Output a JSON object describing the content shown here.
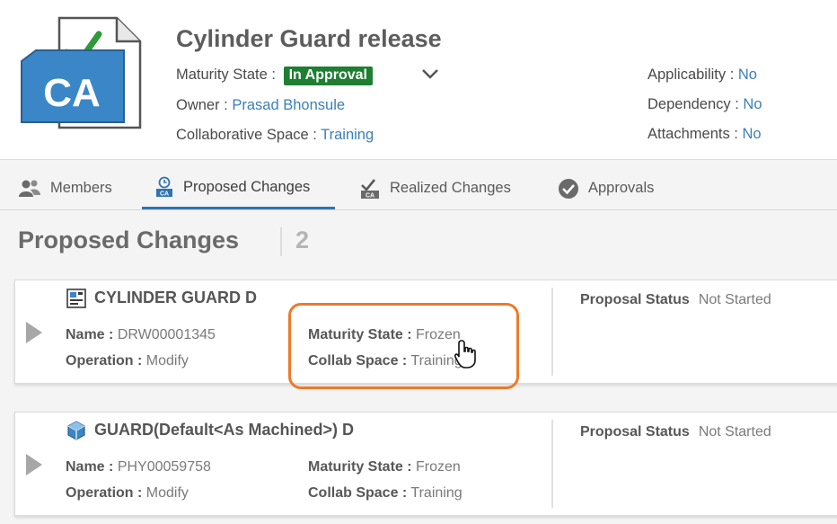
{
  "header": {
    "title": "Cylinder Guard release",
    "icon_text": "CA",
    "maturity_label": "Maturity State :",
    "maturity_value": "In Approval",
    "owner_label": "Owner :",
    "owner_value": "Prasad Bhonsule",
    "space_label": "Collaborative Space :",
    "space_value": "Training",
    "applicability_label": "Applicability :",
    "applicability_value": "No",
    "dependency_label": "Dependency :",
    "dependency_value": "No",
    "attachments_label": "Attachments :",
    "attachments_value": "No"
  },
  "tabs": [
    {
      "label": "Members",
      "icon": "members-icon"
    },
    {
      "label": "Proposed Changes",
      "icon": "proposed-changes-icon",
      "active": true
    },
    {
      "label": "Realized Changes",
      "icon": "realized-changes-icon"
    },
    {
      "label": "Approvals",
      "icon": "approvals-icon"
    }
  ],
  "section": {
    "title": "Proposed Changes",
    "count": "2"
  },
  "cards": [
    {
      "title": "CYLINDER GUARD D",
      "icon": "drawing-icon",
      "name_label": "Name :",
      "name_value": "DRW00001345",
      "operation_label": "Operation :",
      "operation_value": "Modify",
      "maturity_label": "Maturity State :",
      "maturity_value": "Frozen",
      "collab_label": "Collab Space :",
      "collab_value": "Training",
      "status_label": "Proposal Status",
      "status_value": "Not Started"
    },
    {
      "title": "GUARD(Default<As Machined>) D",
      "icon": "part-icon",
      "name_label": "Name :",
      "name_value": "PHY00059758",
      "operation_label": "Operation :",
      "operation_value": "Modify",
      "maturity_label": "Maturity State :",
      "maturity_value": "Frozen",
      "collab_label": "Collab Space :",
      "collab_value": "Training",
      "status_label": "Proposal Status",
      "status_value": "Not Started"
    }
  ],
  "colors": {
    "accent": "#2f73b0",
    "badge": "#1e7f32",
    "link": "#3b7fb6",
    "highlight": "#ec7a2a"
  }
}
